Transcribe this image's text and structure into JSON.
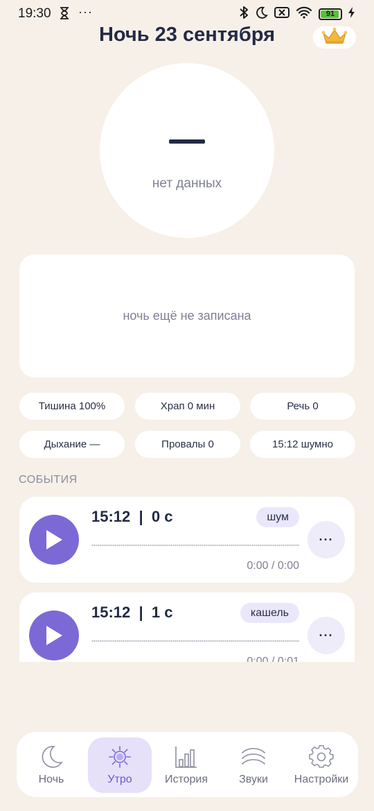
{
  "status_bar": {
    "time": "19:30",
    "dots": "···",
    "battery": "91"
  },
  "header": {
    "title": "Ночь 23 сентября"
  },
  "score": {
    "value": "—",
    "label": "нет данных"
  },
  "summary": {
    "text": "ночь ещё не записана"
  },
  "stats": [
    "Тишина 100%",
    "Храп 0 мин",
    "Речь 0",
    "Дыхание —",
    "Провалы 0",
    "15:12 шумно"
  ],
  "events": {
    "section_label": "СОБЫТИЯ",
    "items": [
      {
        "time": "15:12  |  0 с",
        "tag": "шум",
        "duration": "0:00 / 0:00"
      },
      {
        "time": "15:12  |  1 с",
        "tag": "кашель",
        "duration": "0:00 / 0:01"
      }
    ]
  },
  "nav": {
    "items": [
      {
        "label": "Ночь",
        "icon": "moon-icon"
      },
      {
        "label": "Утро",
        "icon": "sun-icon",
        "active": true
      },
      {
        "label": "История",
        "icon": "bar-chart-icon"
      },
      {
        "label": "Звуки",
        "icon": "waves-icon"
      },
      {
        "label": "Настройки",
        "icon": "gear-icon"
      }
    ]
  },
  "colors": {
    "background": "#f6f0e9",
    "accent": "#7c69d6",
    "active_tab": "#e6e0f8",
    "text": "#232a45"
  }
}
